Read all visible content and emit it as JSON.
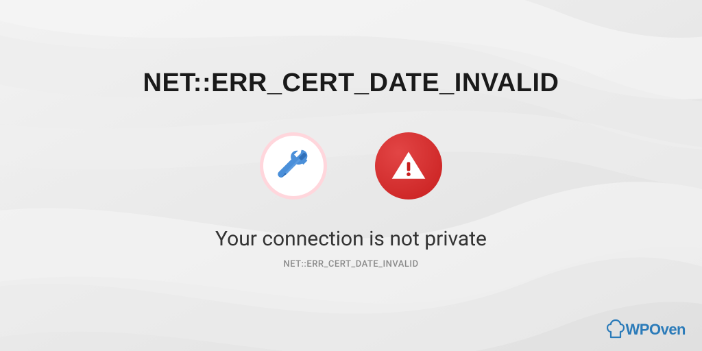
{
  "title": "NET::ERR_CERT_DATE_INVALID",
  "subtitle": "Your connection is not private",
  "errorcode": "NET::ERR_CERT_DATE_INVALID",
  "logo": {
    "text": "WPOven"
  },
  "icons": {
    "tools": "tools-icon",
    "warning": "warning-icon"
  },
  "colors": {
    "brand": "#2b7bb9",
    "warning": "#c81e1e",
    "tool_blue": "#3b82d4",
    "tool_ring": "#ffd6dc"
  }
}
